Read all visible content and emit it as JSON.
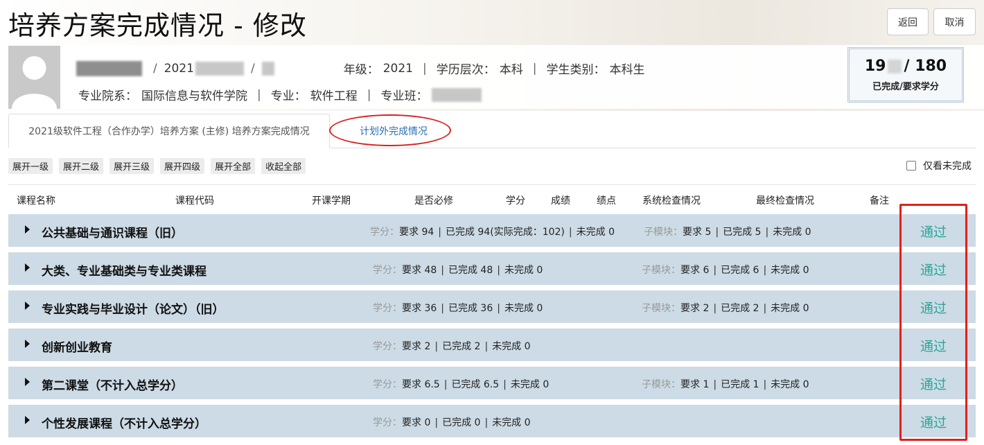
{
  "page": {
    "title": "培养方案完成情况 - 修改",
    "back_label": "返回",
    "cancel_label": "取消"
  },
  "student": {
    "id_prefix": "2021",
    "grade_label": "年级：",
    "grade_value": "2021",
    "level_label": "学历层次：",
    "level_value": "本科",
    "type_label": "学生类别：",
    "type_value": "本科生",
    "department_label": "专业院系：",
    "department_value": "国际信息与软件学院",
    "major_label": "专业：",
    "major_value": "软件工程",
    "class_label": "专业班："
  },
  "credits": {
    "completed_prefix": "19",
    "required": "/ 180",
    "caption": "已完成/要求学分"
  },
  "tabs": [
    {
      "label": "2021级软件工程（合作办学）培养方案 (主修) 培养方案完成情况"
    },
    {
      "label": "计划外完成情况"
    }
  ],
  "toolbar": {
    "buttons": [
      "展开一级",
      "展开二级",
      "展开三级",
      "展开四级",
      "展开全部",
      "收起全部"
    ],
    "only_unfinished_label": "仅看未完成"
  },
  "table": {
    "headers": [
      "课程名称",
      "课程代码",
      "开课学期",
      "是否必修",
      "学分",
      "成绩",
      "绩点",
      "系统检查情况",
      "最终检查情况",
      "备注"
    ],
    "credit_label": "学分：",
    "module_label": "子模块：",
    "rows": [
      {
        "name": "公共基础与通识课程（旧）",
        "req": "要求 94",
        "done": "已完成 94(实际完成：102)",
        "todo": "未完成 0",
        "sub_req": "要求 5",
        "sub_done": "已完成 5",
        "sub_todo": "未完成 0",
        "status": "通过"
      },
      {
        "name": "大类、专业基础类与专业类课程",
        "req": "要求 48",
        "done": "已完成 48",
        "todo": "未完成 0",
        "sub_req": "要求 6",
        "sub_done": "已完成 6",
        "sub_todo": "未完成 0",
        "status": "通过"
      },
      {
        "name": "专业实践与毕业设计（论文）（旧）",
        "req": "要求 36",
        "done": "已完成 36",
        "todo": "未完成 0",
        "sub_req": "要求 2",
        "sub_done": "已完成 2",
        "sub_todo": "未完成 0",
        "status": "通过"
      },
      {
        "name": "创新创业教育",
        "req": "要求 2",
        "done": "已完成 2",
        "todo": "未完成 0",
        "status": "通过"
      },
      {
        "name": "第二课堂（不计入总学分）",
        "req": "要求 6.5",
        "done": "已完成 6.5",
        "todo": "未完成 0",
        "sub_req": "要求 1",
        "sub_done": "已完成 1",
        "sub_todo": "未完成 0",
        "status": "通过"
      },
      {
        "name": "个性发展课程（不计入总学分）",
        "req": "要求 0",
        "done": "已完成 0",
        "todo": "未完成 0",
        "status": "通过"
      }
    ]
  },
  "colors": {
    "row_bg": "#ccdbe5",
    "pass_text": "#2ba59a",
    "highlight_red": "#e0201c",
    "tab_link": "#2a6fb0"
  }
}
